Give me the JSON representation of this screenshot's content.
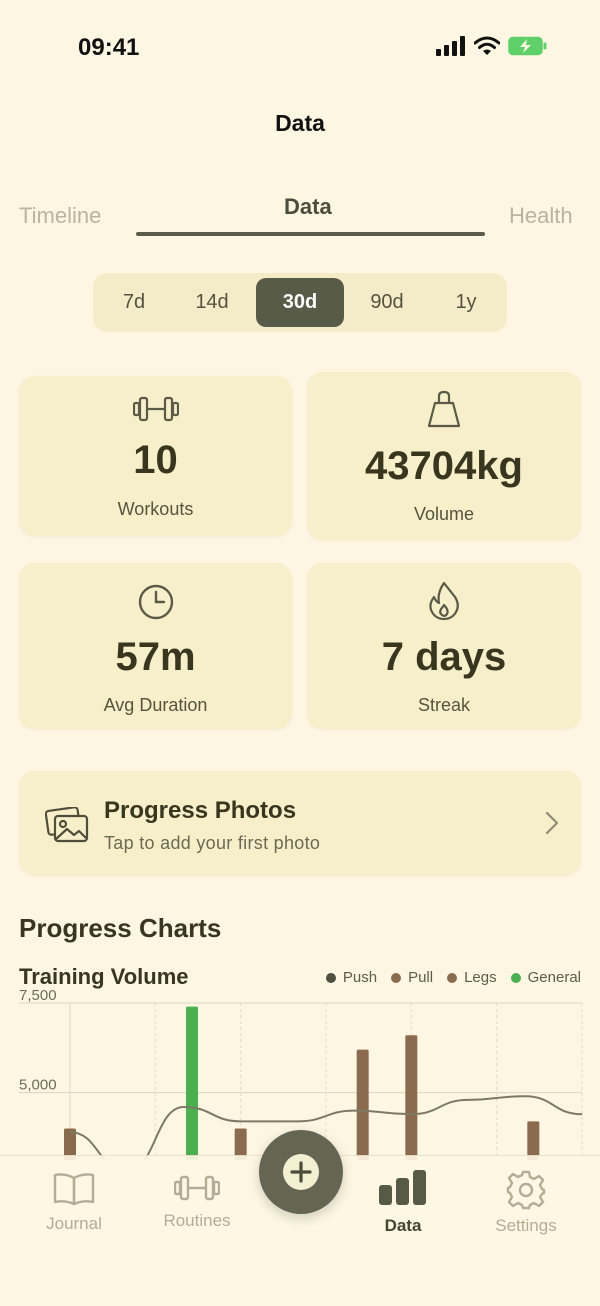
{
  "status": {
    "time": "09:41"
  },
  "nav": {
    "title": "Data"
  },
  "tabs": [
    {
      "label": "Timeline",
      "active": false
    },
    {
      "label": "Data",
      "active": true
    },
    {
      "label": "Health",
      "active": false
    }
  ],
  "ranges": [
    {
      "label": "7d",
      "active": false
    },
    {
      "label": "14d",
      "active": false
    },
    {
      "label": "30d",
      "active": true
    },
    {
      "label": "90d",
      "active": false
    },
    {
      "label": "1y",
      "active": false
    }
  ],
  "stats": [
    {
      "icon": "dumbbell-icon",
      "value": "10",
      "label": "Workouts"
    },
    {
      "icon": "kettlebell-icon",
      "value": "43704kg",
      "label": "Volume"
    },
    {
      "icon": "clock-icon",
      "value": "57m",
      "label": "Avg Duration"
    },
    {
      "icon": "flame-icon",
      "value": "7 days",
      "label": "Streak"
    }
  ],
  "photos": {
    "title": "Progress Photos",
    "subtitle": "Tap to add your first photo"
  },
  "charts_section": {
    "title": "Progress Charts"
  },
  "chart_data": {
    "type": "bar",
    "title": "Training Volume",
    "legend": [
      {
        "name": "Push",
        "color": "#4f4f42"
      },
      {
        "name": "Pull",
        "color": "#8b6b4e"
      },
      {
        "name": "Legs",
        "color": "#8b6b4e"
      },
      {
        "name": "General",
        "color": "#4caf50"
      }
    ],
    "legend_position": "top-right",
    "y_ticks": [
      "7,500",
      "5,000"
    ],
    "ylim": [
      0,
      7500
    ],
    "grid": true,
    "bars": [
      {
        "series": "Pull",
        "value": 4000
      },
      {
        "series": "General",
        "value": 7400
      },
      {
        "series": "Pull",
        "value": 4000
      },
      {
        "series": "Pull",
        "value": 6200
      },
      {
        "series": "Pull",
        "value": 6600
      },
      {
        "series": "Pull",
        "value": 4200
      }
    ],
    "trend": [
      3900,
      2800,
      4600,
      4200,
      4200,
      4500,
      4400,
      4800,
      4900,
      4400
    ]
  },
  "tab_bar": {
    "items": [
      {
        "label": "Journal",
        "icon": "book-icon",
        "active": false
      },
      {
        "label": "Routines",
        "icon": "dumbbell-icon",
        "active": false
      },
      {
        "label": "Data",
        "icon": "bar-chart-icon",
        "active": true
      },
      {
        "label": "Settings",
        "icon": "gear-icon",
        "active": false
      }
    ],
    "fab_icon": "plus-icon"
  }
}
